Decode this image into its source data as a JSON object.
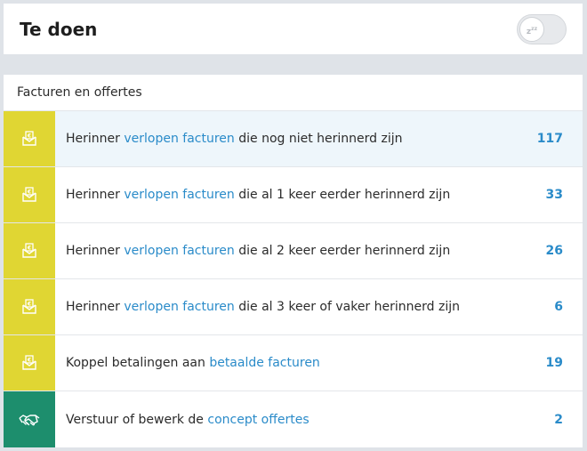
{
  "header": {
    "title": "Te doen",
    "snooze_label": "zzz"
  },
  "panel": {
    "title": "Facturen en offertes",
    "rows": [
      {
        "prefix": "Herinner ",
        "link": "verlopen facturen",
        "suffix": " die nog niet herinnerd zijn",
        "count": "117",
        "icon": "envelope-euro-icon",
        "color": "#e0d633"
      },
      {
        "prefix": "Herinner ",
        "link": "verlopen facturen",
        "suffix": " die al 1 keer eerder herinnerd zijn",
        "count": "33",
        "icon": "envelope-euro-icon",
        "color": "#e0d633"
      },
      {
        "prefix": "Herinner ",
        "link": "verlopen facturen",
        "suffix": " die al 2 keer eerder herinnerd zijn",
        "count": "26",
        "icon": "envelope-euro-icon",
        "color": "#e0d633"
      },
      {
        "prefix": "Herinner ",
        "link": "verlopen facturen",
        "suffix": " die al 3 keer of vaker herinnerd zijn",
        "count": "6",
        "icon": "envelope-euro-icon",
        "color": "#e0d633"
      },
      {
        "prefix": "Koppel betalingen aan ",
        "link": "betaalde facturen",
        "suffix": "",
        "count": "19",
        "icon": "envelope-euro-icon",
        "color": "#e0d633"
      },
      {
        "prefix": "Verstuur of bewerk de ",
        "link": "concept offertes",
        "suffix": "",
        "count": "2",
        "icon": "handshake-icon",
        "color": "#1d8e6d"
      }
    ]
  },
  "colors": {
    "link": "#2a8bc9",
    "invoice_accent": "#e0d633",
    "quote_accent": "#1d8e6d",
    "highlight_row": "#eef6fb"
  }
}
